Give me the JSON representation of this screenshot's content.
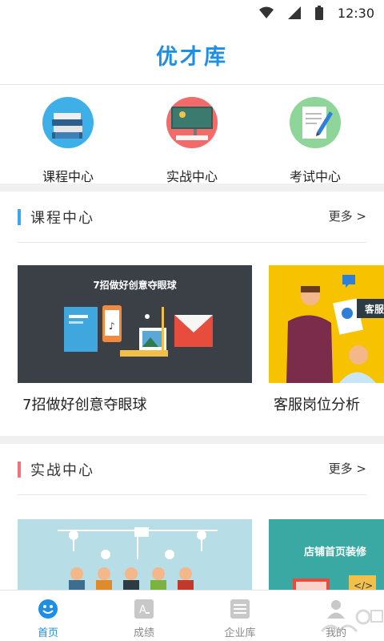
{
  "status_bar": {
    "time": "12:30",
    "icons": [
      "wifi-icon",
      "signal-icon",
      "battery-icon"
    ]
  },
  "header": {
    "title": "优才库"
  },
  "quick_nav": [
    {
      "label": "课程中心",
      "icon": "books-icon"
    },
    {
      "label": "实战中心",
      "icon": "board-icon"
    },
    {
      "label": "考试中心",
      "icon": "exam-icon"
    }
  ],
  "sections": [
    {
      "title": "课程中心",
      "more": "更多 >",
      "accent": "#3ba7e8",
      "cards": [
        {
          "title": "7招做好创意夺眼球",
          "image_caption": "7招做好创意夺眼球",
          "image_icon": "creative-design-illustration"
        },
        {
          "title": "客服岗位分析",
          "image_caption": "客服",
          "image_icon": "customer-service-illustration"
        }
      ]
    },
    {
      "title": "实战中心",
      "more": "更多 >",
      "accent": "#f27079",
      "cards": [
        {
          "title": "",
          "image_caption": "",
          "image_icon": "team-meeting-illustration"
        },
        {
          "title": "",
          "image_caption": "店铺首页装修",
          "image_icon": "shop-decoration-illustration"
        }
      ]
    }
  ],
  "tab_bar": [
    {
      "label": "首页",
      "icon": "home-smile-icon",
      "active": true
    },
    {
      "label": "成绩",
      "icon": "grade-icon",
      "active": false
    },
    {
      "label": "企业库",
      "icon": "company-icon",
      "active": false
    },
    {
      "label": "我的",
      "icon": "user-icon",
      "active": false
    }
  ],
  "colors": {
    "brand": "#1e8fe3",
    "section1_accent": "#3ba7e8",
    "section2_accent": "#f27079",
    "gap": "#f0f0f0"
  }
}
